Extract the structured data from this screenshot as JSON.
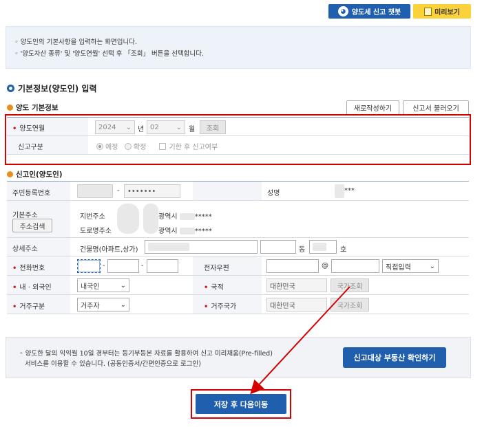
{
  "top": {
    "chatbot_label": "양도세 신고 챗봇",
    "preview_label": "미리보기"
  },
  "info": {
    "line1": "◦ 양도인의 기본사항을 입력하는 화면입니다.",
    "line2": "◦ '양도자산 종류' 및 '양도연월' 선택 후 「조회」 버튼을 선택합니다."
  },
  "section_title": "기본정보(양도인) 입력",
  "basic": {
    "title": "양도 기본정보",
    "new_btn": "새로작성하기",
    "load_btn": "신고서 불러오기",
    "year_label": "양도연월",
    "year_value": "2024",
    "year_unit": "년",
    "month_value": "02",
    "month_unit": "월",
    "search_btn": "조회",
    "type_label": "신고구분",
    "opt_scheduled": "예정",
    "opt_final": "확정",
    "opt_late": "기한 후 신고여부"
  },
  "reporter": {
    "title": "신고인(양도인)",
    "rrn_label": "주민등록번호",
    "rrn_dash": "-",
    "rrn_masked": "•••••••",
    "name_label": "성명",
    "name_masked": "***",
    "addr_label": "기본주소",
    "addr_search_btn": "주소검색",
    "jibun_label": "지번주소",
    "jibun_value": "광역시 ",
    "jibun_mask": "*****",
    "road_label": "도로명주소",
    "road_value": "광역시 ",
    "road_mask": "*****",
    "detail_label": "상세주소",
    "building_label": "건물명(아파트,상가)",
    "dong_unit": "동",
    "ho_unit": "호",
    "phone_label": "전화번호",
    "phone_dash1": "-",
    "phone_dash2": "-",
    "email_label": "전자우편",
    "email_at": "@",
    "email_domain_select": "직접입력",
    "nationality_type_label": "내 · 외국인",
    "nationality_type_value": "내국인",
    "country_label": "국적",
    "country_value": "대한민국",
    "country_btn": "국가조회",
    "residence_label": "거주구분",
    "residence_value": "거주자",
    "residence_country_label": "거주국가",
    "residence_country_value": "대한민국",
    "residence_country_btn": "국가조회"
  },
  "bottom": {
    "notice_line1": "◦ 양도한 달의 익익월 10일 경부터는 등기부등본 자료를 활용하여 신고 미리채움(Pre-filled)",
    "notice_line2": "서비스를 이용할 수 있습니다. (공동인증서/간편인증으로 로그인)",
    "confirm_btn": "신고대상 부동산 확인하기",
    "save_btn": "저장 후 다음이동"
  },
  "colors": {
    "primary": "#1f5fad",
    "highlight": "#d40000",
    "preview": "#fbd23a"
  }
}
